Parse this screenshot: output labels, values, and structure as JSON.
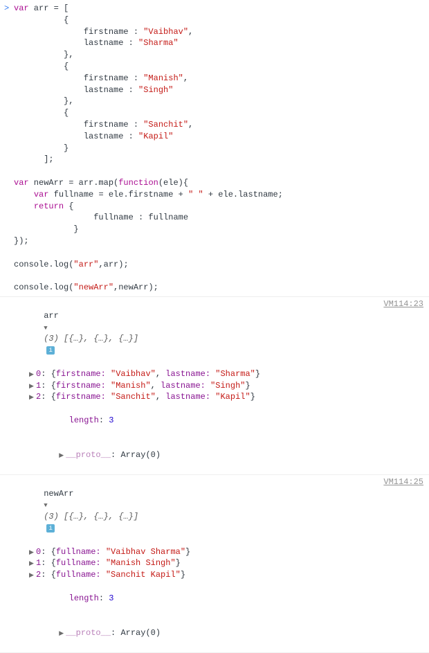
{
  "input": {
    "prompt": ">",
    "code_tokens": [
      [
        [
          "kw",
          "var"
        ],
        [
          "",
          " arr "
        ],
        [
          "op",
          "="
        ],
        [
          "",
          " ["
        ]
      ],
      [
        [
          "",
          "          {"
        ]
      ],
      [
        [
          "",
          "              firstname "
        ],
        [
          "op",
          ":"
        ],
        [
          "",
          " "
        ],
        [
          "str",
          "\"Vaibhav\""
        ],
        [
          "",
          ","
        ]
      ],
      [
        [
          "",
          "              lastname "
        ],
        [
          "op",
          ":"
        ],
        [
          "",
          " "
        ],
        [
          "str",
          "\"Sharma\""
        ]
      ],
      [
        [
          "",
          "          },"
        ]
      ],
      [
        [
          "",
          "          {"
        ]
      ],
      [
        [
          "",
          "              firstname "
        ],
        [
          "op",
          ":"
        ],
        [
          "",
          " "
        ],
        [
          "str",
          "\"Manish\""
        ],
        [
          "",
          ","
        ]
      ],
      [
        [
          "",
          "              lastname "
        ],
        [
          "op",
          ":"
        ],
        [
          "",
          " "
        ],
        [
          "str",
          "\"Singh\""
        ]
      ],
      [
        [
          "",
          "          },"
        ]
      ],
      [
        [
          "",
          "          {"
        ]
      ],
      [
        [
          "",
          "              firstname "
        ],
        [
          "op",
          ":"
        ],
        [
          "",
          " "
        ],
        [
          "str",
          "\"Sanchit\""
        ],
        [
          "",
          ","
        ]
      ],
      [
        [
          "",
          "              lastname "
        ],
        [
          "op",
          ":"
        ],
        [
          "",
          " "
        ],
        [
          "str",
          "\"Kapil\""
        ]
      ],
      [
        [
          "",
          "          }"
        ]
      ],
      [
        [
          "",
          "      ];"
        ]
      ],
      [
        [
          "",
          ""
        ]
      ],
      [
        [
          "kw",
          "var"
        ],
        [
          "",
          " newArr "
        ],
        [
          "op",
          "="
        ],
        [
          "",
          " arr.map("
        ],
        [
          "fn",
          "function"
        ],
        [
          "",
          "(ele){"
        ]
      ],
      [
        [
          "",
          "    "
        ],
        [
          "kw",
          "var"
        ],
        [
          "",
          " fullname "
        ],
        [
          "op",
          "="
        ],
        [
          "",
          " ele.firstname "
        ],
        [
          "op",
          "+"
        ],
        [
          "",
          " "
        ],
        [
          "str",
          "\" \""
        ],
        [
          "",
          " "
        ],
        [
          "op",
          "+"
        ],
        [
          "",
          " ele.lastname;"
        ]
      ],
      [
        [
          "",
          "    "
        ],
        [
          "kw",
          "return"
        ],
        [
          "",
          " {"
        ]
      ],
      [
        [
          "",
          "                fullname "
        ],
        [
          "op",
          ":"
        ],
        [
          "",
          " fullname"
        ]
      ],
      [
        [
          "",
          "            }"
        ]
      ],
      [
        [
          "",
          "});"
        ]
      ],
      [
        [
          "",
          ""
        ]
      ],
      [
        [
          "",
          "console.log("
        ],
        [
          "str",
          "\"arr\""
        ],
        [
          "",
          ",arr);"
        ]
      ],
      [
        [
          "",
          ""
        ]
      ],
      [
        [
          "",
          "console.log("
        ],
        [
          "str",
          "\"newArr\""
        ],
        [
          "",
          ",newArr);"
        ]
      ]
    ]
  },
  "output1": {
    "label": "arr",
    "length": "3",
    "summary": "(3) [{…}, {…}, {…}]",
    "source": "VM114:23",
    "items": [
      {
        "idx": "0",
        "body": [
          [
            "",
            "{"
          ],
          [
            "okey",
            "firstname: "
          ],
          [
            "ostr",
            "\"Vaibhav\""
          ],
          [
            "",
            ", "
          ],
          [
            "okey",
            "lastname: "
          ],
          [
            "ostr",
            "\"Sharma\""
          ],
          [
            "",
            "}"
          ]
        ]
      },
      {
        "idx": "1",
        "body": [
          [
            "",
            "{"
          ],
          [
            "okey",
            "firstname: "
          ],
          [
            "ostr",
            "\"Manish\""
          ],
          [
            "",
            ", "
          ],
          [
            "okey",
            "lastname: "
          ],
          [
            "ostr",
            "\"Singh\""
          ],
          [
            "",
            "}"
          ]
        ]
      },
      {
        "idx": "2",
        "body": [
          [
            "",
            "{"
          ],
          [
            "okey",
            "firstname: "
          ],
          [
            "ostr",
            "\"Sanchit\""
          ],
          [
            "",
            ", "
          ],
          [
            "okey",
            "lastname: "
          ],
          [
            "ostr",
            "\"Kapil\""
          ],
          [
            "",
            "}"
          ]
        ]
      }
    ],
    "length_label": "length",
    "proto_label": "__proto__",
    "proto_val": "Array(0)"
  },
  "output2": {
    "label": "newArr",
    "length": "3",
    "summary": "(3) [{…}, {…}, {…}]",
    "source": "VM114:25",
    "items": [
      {
        "idx": "0",
        "body": [
          [
            "",
            "{"
          ],
          [
            "okey",
            "fullname: "
          ],
          [
            "ostr",
            "\"Vaibhav Sharma\""
          ],
          [
            "",
            "}"
          ]
        ]
      },
      {
        "idx": "1",
        "body": [
          [
            "",
            "{"
          ],
          [
            "okey",
            "fullname: "
          ],
          [
            "ostr",
            "\"Manish Singh\""
          ],
          [
            "",
            "}"
          ]
        ]
      },
      {
        "idx": "2",
        "body": [
          [
            "",
            "{"
          ],
          [
            "okey",
            "fullname: "
          ],
          [
            "ostr",
            "\"Sanchit Kapil\""
          ],
          [
            "",
            "}"
          ]
        ]
      }
    ],
    "length_label": "length",
    "proto_label": "__proto__",
    "proto_val": "Array(0)"
  },
  "info_icon": "i"
}
